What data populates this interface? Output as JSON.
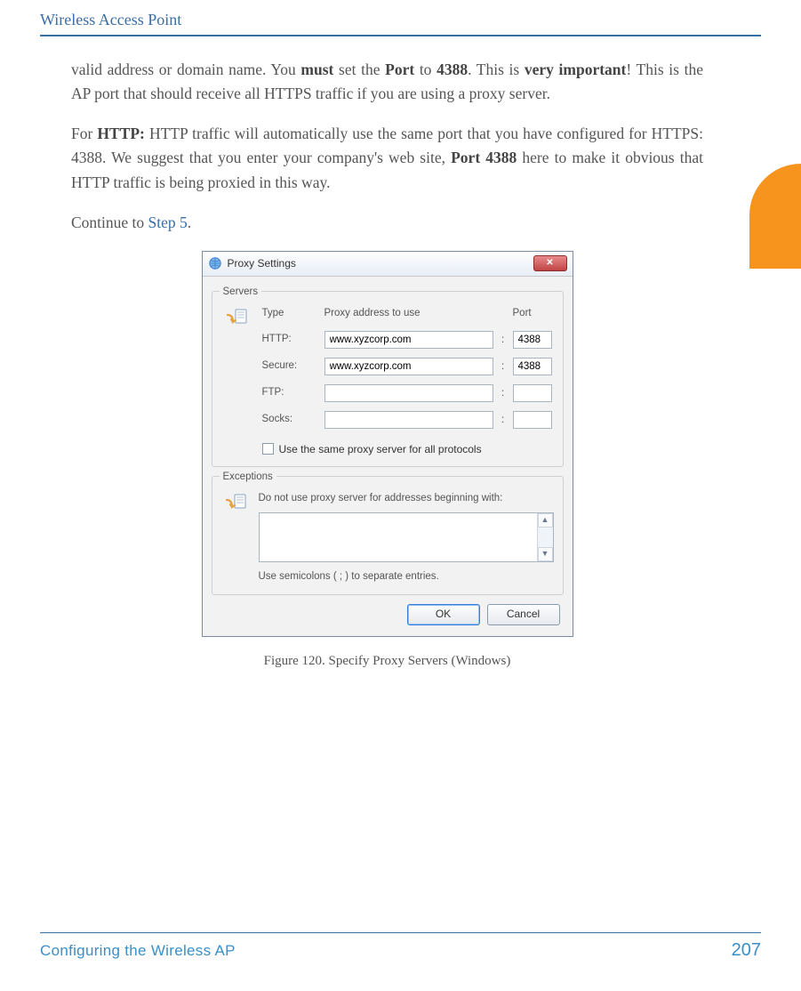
{
  "header": {
    "title": "Wireless Access Point"
  },
  "body": {
    "p1_a": "valid address or domain name. You ",
    "p1_b": "must",
    "p1_c": " set the ",
    "p1_d": "Port",
    "p1_e": " to ",
    "p1_f": "4388",
    "p1_g": ". This is ",
    "p1_h": "very important",
    "p1_i": "! This is the AP port that should receive all HTTPS traffic if you are using a proxy server.",
    "p2_a": "For ",
    "p2_b": "HTTP:",
    "p2_c": " HTTP traffic will automatically use the same port that you have configured for HTTPS: 4388. We suggest that you enter your company's web site, ",
    "p2_d": "Port 4388",
    "p2_e": " here to make it obvious that HTTP traffic is being proxied in this way.",
    "p3_a": "Continue to ",
    "p3_link": "Step 5",
    "p3_b": "."
  },
  "dialog": {
    "title": "Proxy Settings",
    "servers_legend": "Servers",
    "hdr_type": "Type",
    "hdr_addr": "Proxy address to use",
    "hdr_port": "Port",
    "rows": [
      {
        "label": "HTTP:",
        "addr": "www.xyzcorp.com",
        "port": "4388"
      },
      {
        "label": "Secure:",
        "addr": "www.xyzcorp.com",
        "port": "4388"
      },
      {
        "label": "FTP:",
        "addr": "",
        "port": ""
      },
      {
        "label": "Socks:",
        "addr": "",
        "port": ""
      }
    ],
    "same_proxy_label": "Use the same proxy server for all protocols",
    "exceptions_legend": "Exceptions",
    "exceptions_label": "Do not use proxy server for addresses beginning with:",
    "exceptions_hint": "Use semicolons ( ; ) to separate entries.",
    "btn_ok": "OK",
    "btn_cancel": "Cancel"
  },
  "figure_caption": "Figure 120. Specify Proxy Servers (Windows)",
  "footer": {
    "left": "Configuring the Wireless AP",
    "right": "207"
  }
}
